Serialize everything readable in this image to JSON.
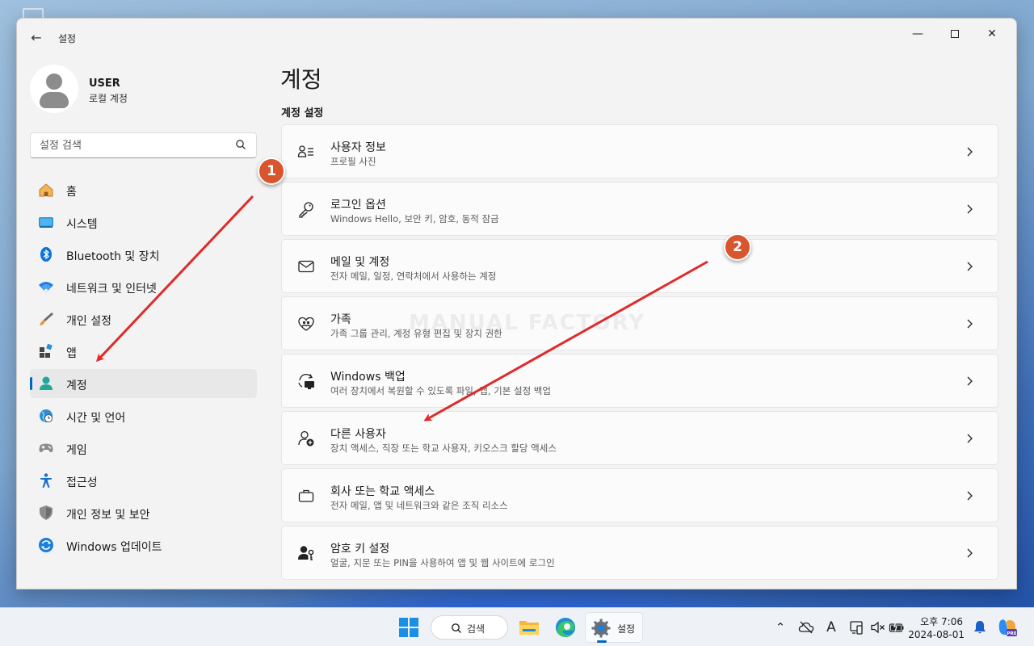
{
  "window": {
    "title": "설정"
  },
  "profile": {
    "name": "USER",
    "account_type": "로컬 계정"
  },
  "search": {
    "placeholder": "설정 검색"
  },
  "nav": {
    "items": [
      {
        "label": "홈",
        "icon": "home-icon"
      },
      {
        "label": "시스템",
        "icon": "system-icon"
      },
      {
        "label": "Bluetooth 및 장치",
        "icon": "bluetooth-icon"
      },
      {
        "label": "네트워크 및 인터넷",
        "icon": "wifi-icon"
      },
      {
        "label": "개인 설정",
        "icon": "brush-icon"
      },
      {
        "label": "앱",
        "icon": "apps-icon"
      },
      {
        "label": "계정",
        "icon": "account-icon",
        "active": true
      },
      {
        "label": "시간 및 언어",
        "icon": "globe-clock-icon"
      },
      {
        "label": "게임",
        "icon": "gamepad-icon"
      },
      {
        "label": "접근성",
        "icon": "accessibility-icon"
      },
      {
        "label": "개인 정보 및 보안",
        "icon": "shield-icon"
      },
      {
        "label": "Windows 업데이트",
        "icon": "update-icon"
      }
    ]
  },
  "main": {
    "title": "계정",
    "section_title": "계정 설정",
    "cards": [
      {
        "title": "사용자 정보",
        "desc": "프로필 사진",
        "icon": "user-info-icon"
      },
      {
        "title": "로그인 옵션",
        "desc": "Windows Hello, 보안 키, 암호, 동적 잠금",
        "icon": "key-icon"
      },
      {
        "title": "메일 및 계정",
        "desc": "전자 메일, 일정, 연락처에서 사용하는 계정",
        "icon": "mail-icon"
      },
      {
        "title": "가족",
        "desc": "가족 그룹 관리, 계정 유형 편집 및 장치 권한",
        "icon": "family-heart-icon"
      },
      {
        "title": "Windows 백업",
        "desc": "여러 장치에서 복원할 수 있도록 파일, 앱, 기본 설정 백업",
        "icon": "backup-icon"
      },
      {
        "title": "다른 사용자",
        "desc": "장치 액세스, 직장 또는 학교 사용자, 키오스크 할당 액세스",
        "icon": "add-user-icon"
      },
      {
        "title": "회사 또는 학교 액세스",
        "desc": "전자 메일, 앱 및 네트워크와 같은 조직 리소스",
        "icon": "briefcase-icon"
      },
      {
        "title": "암호 키 설정",
        "desc": "얼굴, 지문 또는 PIN을 사용하여 앱 및 웹 사이트에 로그인",
        "icon": "passkey-icon"
      }
    ]
  },
  "watermark": "MANUAL FACTORY",
  "annotations": {
    "badge_1": "1",
    "badge_2": "2",
    "color": "#d9552e"
  },
  "taskbar": {
    "search_label": "검색",
    "settings_label": "설정",
    "ime_label": "A",
    "time": "오후 7:06",
    "date": "2024-08-01"
  },
  "colors": {
    "accent": "#0067c0",
    "arrow": "#e02a2a"
  }
}
